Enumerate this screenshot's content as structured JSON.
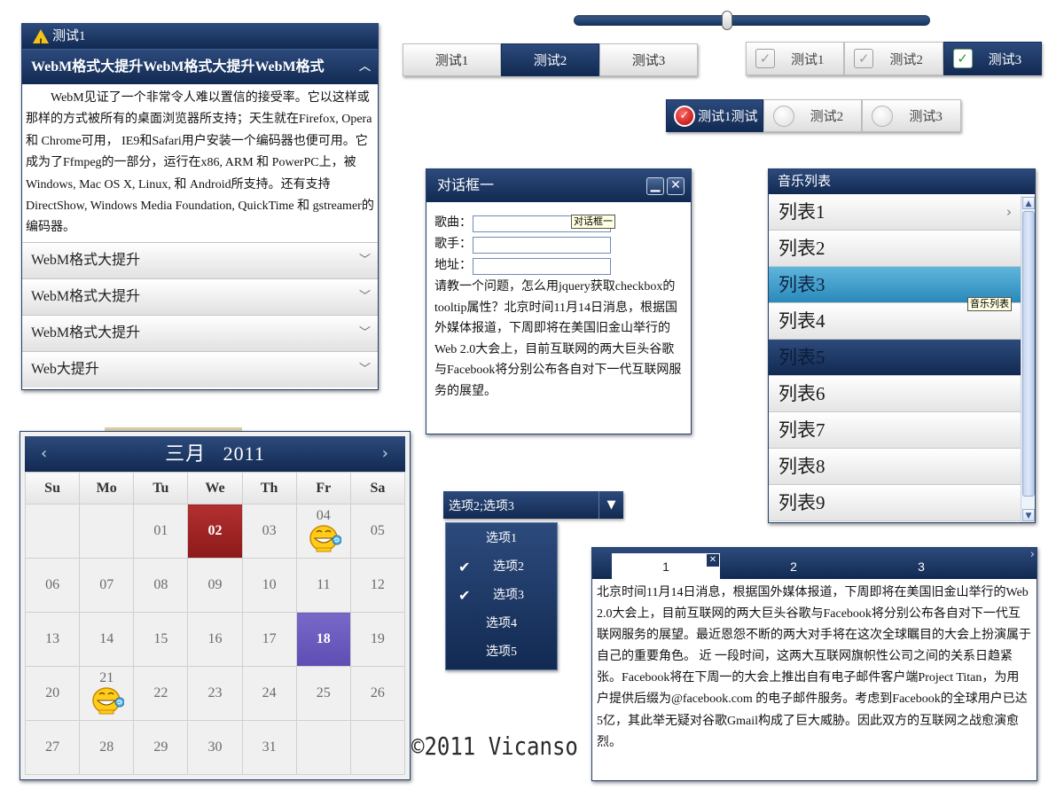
{
  "accordion": {
    "title": "测试1",
    "active_header": "WebM格式大提升WebM格式大提升WebM格式",
    "content": "WebM见证了一个非常令人难以置信的接受率。它以这样或那样的方式被所有的桌面浏览器所支持；天生就在Firefox, Opera 和 Chrome可用， IE9和Safari用户安装一个编码器也便可用。它成为了Ffmpeg的一部分，运行在x86, ARM 和 PowerPC上，被Windows, Mac OS X, Linux, 和 Android所支持。还有支持DirectShow, Windows Media Foundation, QuickTime 和 gstreamer的编码器。",
    "items": [
      {
        "label": "WebM格式大提升"
      },
      {
        "label": "WebM格式大提升"
      },
      {
        "label": "WebM格式大提升"
      },
      {
        "label": "Web大提升"
      }
    ]
  },
  "slider": {
    "value": 0.43
  },
  "seg_buttons": [
    {
      "label": "测试1",
      "active": false
    },
    {
      "label": "测试2",
      "active": true
    },
    {
      "label": "测试3",
      "active": false
    }
  ],
  "check_buttons": [
    {
      "label": "测试1",
      "checked": false
    },
    {
      "label": "测试2",
      "checked": false
    },
    {
      "label": "测试3",
      "checked": true
    }
  ],
  "radio_buttons": [
    {
      "label": "测试1测试",
      "checked": true
    },
    {
      "label": "测试2",
      "checked": false
    },
    {
      "label": "测试3",
      "checked": false
    }
  ],
  "dialog": {
    "title": "对话框一",
    "tooltip": "对话框一",
    "song_label": "歌曲：",
    "singer_label": "歌手：",
    "address_label": "地址：",
    "song_value": "",
    "singer_value": "",
    "address_value": "",
    "body": "请教一个问题，怎么用jquery获取checkbox的tooltip属性？北京时间11月14日消息，根据国外媒体报道，下周即将在美国旧金山举行的Web 2.0大会上，目前互联网的两大巨头谷歌与Facebook将分别公布各自对下一代互联网服务的展望。"
  },
  "music": {
    "title": "音乐列表",
    "tooltip": "音乐列表",
    "items": [
      "列表1",
      "列表2",
      "列表3",
      "列表4",
      "列表5",
      "列表6",
      "列表7",
      "列表8",
      "列表9"
    ]
  },
  "calendar": {
    "month_label": "三月",
    "year_label": "2011",
    "weekdays": [
      "Su",
      "Mo",
      "Tu",
      "We",
      "Th",
      "Fr",
      "Sa"
    ],
    "weeks": [
      [
        "",
        "",
        "01",
        "02",
        "03",
        "04",
        "05"
      ],
      [
        "06",
        "07",
        "08",
        "09",
        "10",
        "11",
        "12"
      ],
      [
        "13",
        "14",
        "15",
        "16",
        "17",
        "18",
        "19"
      ],
      [
        "20",
        "21",
        "22",
        "23",
        "24",
        "25",
        "26"
      ],
      [
        "27",
        "28",
        "29",
        "30",
        "31",
        "",
        ""
      ]
    ],
    "today": "02",
    "selected": "18",
    "event_days": [
      "04",
      "21"
    ]
  },
  "select": {
    "value": "选项2;选项3",
    "options": [
      {
        "label": "选项1",
        "checked": false
      },
      {
        "label": "选项2",
        "checked": true
      },
      {
        "label": "选项3",
        "checked": true
      },
      {
        "label": "选项4",
        "checked": false
      },
      {
        "label": "选项5",
        "checked": false
      }
    ]
  },
  "tabs": {
    "labels": [
      "1",
      "2",
      "3"
    ],
    "content": "北京时间11月14日消息，根据国外媒体报道，下周即将在美国旧金山举行的Web 2.0大会上，目前互联网的两大巨头谷歌与Facebook将分别公布各自对下一代互联网服务的展望。最近恩怨不断的两大对手将在这次全球瞩目的大会上扮演属于自己的重要角色。 近 一段时间，这两大互联网旗帜性公司之间的关系日趋紧张。Facebook将在下周一的大会上推出自有电子邮件客户端Project Titan，为用户提供后缀为@facebook.com 的电子邮件服务。考虑到Facebook的全球用户已达5亿，其此举无疑对谷歌Gmail构成了巨大威胁。因此双方的互联网之战愈演愈烈。"
  },
  "copyright": "©2011 Vicanso",
  "colors": {
    "navy_top": "#2c4a7c",
    "navy_bottom": "#122a52",
    "hover_blue": "#2a89ba",
    "today_red": "#9e2222",
    "selected_purple": "#6a5abe",
    "check_green": "#2a9c28"
  }
}
